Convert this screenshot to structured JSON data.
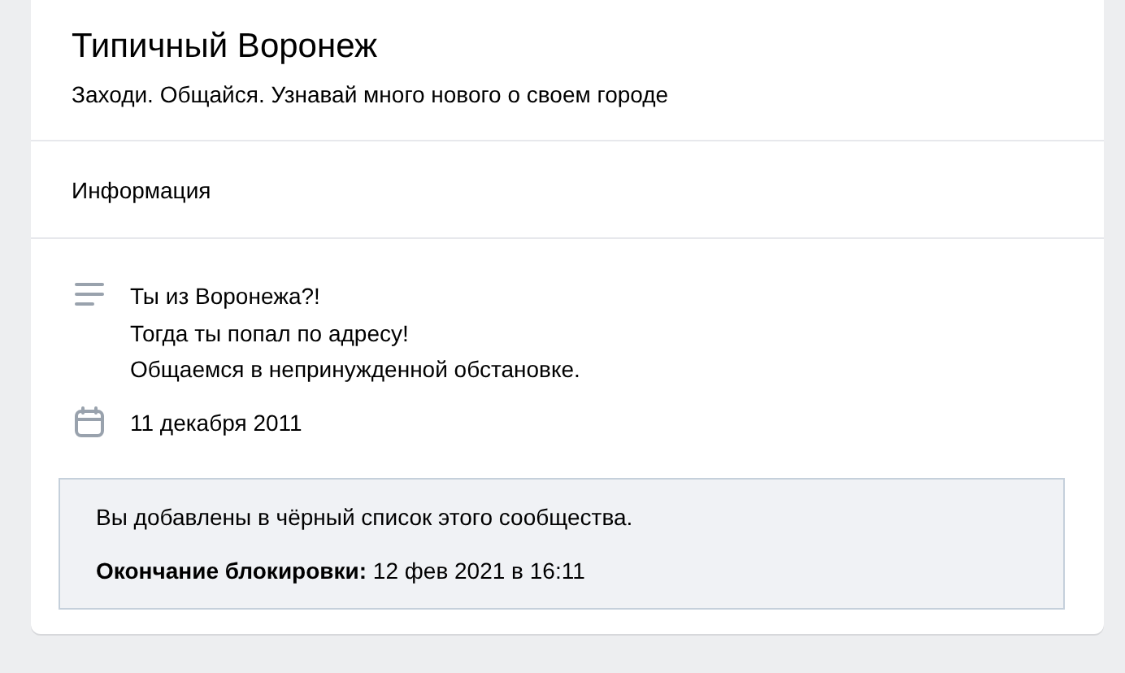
{
  "group": {
    "name": "Типичный Воронеж",
    "status": "Заходи. Общайся. Узнавай много нового о своем городе"
  },
  "section_title": "Информация",
  "info": [
    {
      "kind": "description",
      "text": "Ты из Воронежа?!\nТогда ты попал по адресу!\nОбщаемся в непринужденной обстановке."
    },
    {
      "kind": "date",
      "text": "11 декабря 2011"
    }
  ],
  "notice": {
    "message": "Вы добавлены в чёрный список этого сообщества.",
    "detail": "**Окончание блокировки:** 12 фев 2021 в 16:11"
  }
}
